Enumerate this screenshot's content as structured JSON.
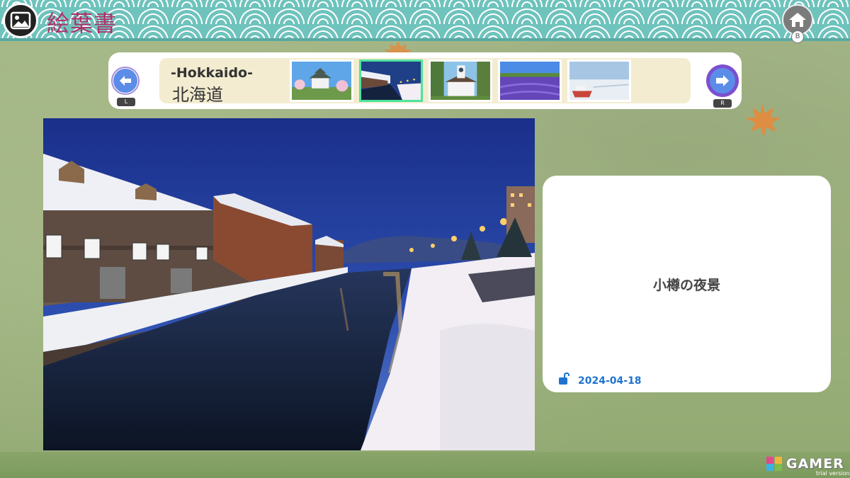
{
  "app": {
    "title": "絵葉書",
    "home_hint": "B"
  },
  "selector": {
    "region_en": "-Hokkaido-",
    "region_jp": "北海道",
    "prev_hint": "L",
    "next_hint": "R",
    "selected_index": 1,
    "thumbnails": [
      {
        "scene": "castle-park"
      },
      {
        "scene": "otaru-canal-night"
      },
      {
        "scene": "clock-tower"
      },
      {
        "scene": "lavender-field"
      },
      {
        "scene": "drift-ice-ship"
      }
    ]
  },
  "card": {
    "title": "小樽の夜景",
    "date": "2024-04-18",
    "lock_state": "unlocked-lock-icon"
  },
  "watermark": {
    "brand": "GAMER",
    "sub": "trial version"
  },
  "colors": {
    "header_teal": "#6fc3bd",
    "title_magenta": "#b0306a",
    "selected_green": "#4ee39c",
    "date_blue": "#1f73d0",
    "nav_blue": "#5b8de8"
  }
}
